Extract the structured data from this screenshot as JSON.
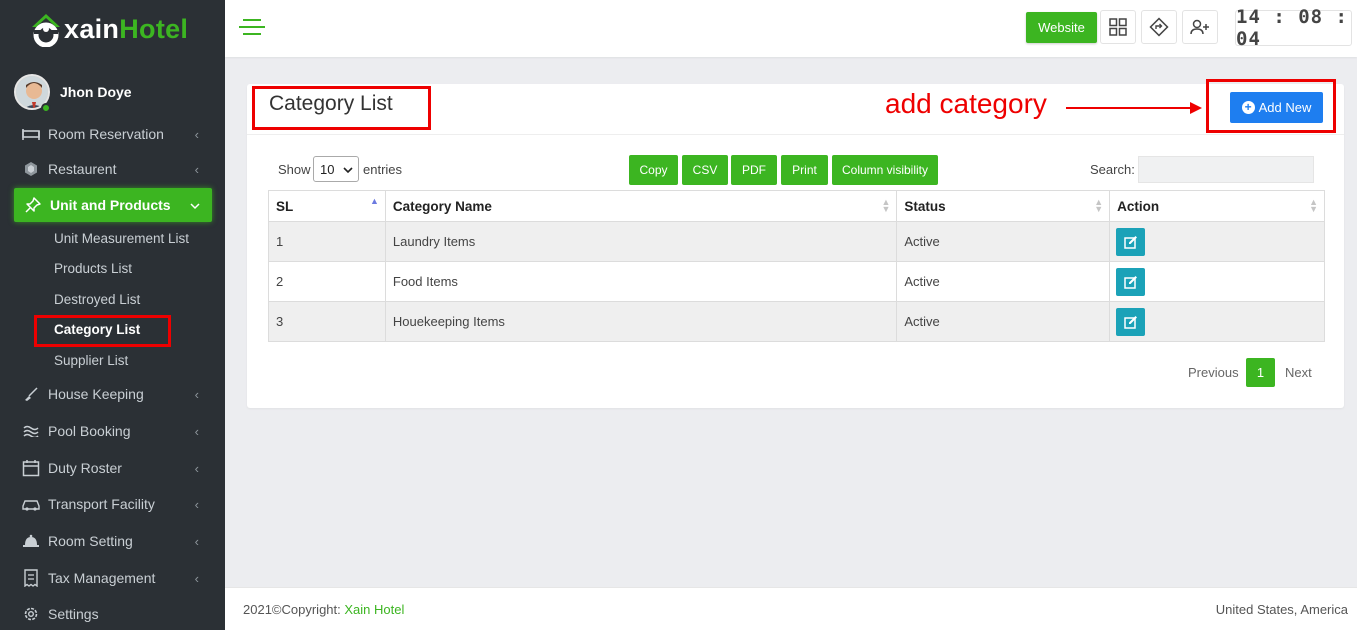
{
  "app": {
    "logo_text_white": "xain",
    "logo_text_green": "Hotel",
    "user_name": "Jhon Doye"
  },
  "sidebar": {
    "items": [
      {
        "label": "Room Reservation",
        "icon": "bed-icon"
      },
      {
        "label": "Restaurent",
        "icon": "hexagon-icon"
      },
      {
        "label": "Unit and Products",
        "icon": "pin-icon",
        "active": true
      },
      {
        "label": "House Keeping",
        "icon": "broom-icon"
      },
      {
        "label": "Pool Booking",
        "icon": "waves-icon"
      },
      {
        "label": "Duty Roster",
        "icon": "calendar-icon"
      },
      {
        "label": "Transport Facility",
        "icon": "car-icon"
      },
      {
        "label": "Room Setting",
        "icon": "bell-icon"
      },
      {
        "label": "Tax Management",
        "icon": "receipt-icon"
      },
      {
        "label": "Settings",
        "icon": "gear-icon"
      }
    ],
    "subitems": [
      {
        "label": "Unit Measurement List"
      },
      {
        "label": "Products List"
      },
      {
        "label": "Destroyed List"
      },
      {
        "label": "Category List",
        "current": true
      },
      {
        "label": "Supplier List"
      }
    ]
  },
  "topbar": {
    "website_label": "Website",
    "clock": "14 : 08 : 04"
  },
  "page": {
    "title": "Category List",
    "annotation": "add category",
    "add_label": "Add New"
  },
  "datatable": {
    "show_label": "Show",
    "page_length": "10",
    "entries_label": "entries",
    "buttons": [
      "Copy",
      "CSV",
      "PDF",
      "Print",
      "Column visibility"
    ],
    "search_label": "Search:",
    "search_value": "",
    "columns": [
      "SL",
      "Category Name",
      "Status",
      "Action"
    ],
    "rows": [
      {
        "sl": "1",
        "name": "Laundry Items",
        "status": "Active"
      },
      {
        "sl": "2",
        "name": "Food Items",
        "status": "Active"
      },
      {
        "sl": "3",
        "name": "Houekeeping Items",
        "status": "Active"
      }
    ],
    "prev_label": "Previous",
    "current_page": "1",
    "next_label": "Next"
  },
  "footer": {
    "copyright_prefix": "2021©Copyright: ",
    "brand": "Xain Hotel",
    "location": "United States, America"
  },
  "colors": {
    "accent_green": "#3cb521",
    "primary_blue": "#1e7ef0",
    "edit_teal": "#1ba2b8",
    "annotation_red": "#e00000"
  }
}
